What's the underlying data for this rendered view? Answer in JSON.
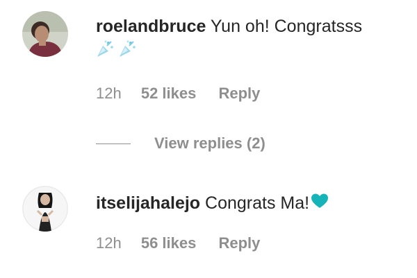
{
  "comments": [
    {
      "username": "roelandbruce",
      "message": "Yun oh! Congratsss",
      "emoji": [
        "party-popper-icon",
        "party-popper-icon"
      ],
      "time": "12h",
      "likes": "52 likes",
      "reply_label": "Reply",
      "view_replies_label": "View replies (2)"
    },
    {
      "username": "itselijahalejo",
      "message": "Congrats Ma!",
      "emoji": [
        "teal-heart-icon"
      ],
      "time": "12h",
      "likes": "56 likes",
      "reply_label": "Reply"
    }
  ],
  "colors": {
    "text": "#262626",
    "secondary": "#8e8e8e",
    "heart": "#16b3b8"
  }
}
